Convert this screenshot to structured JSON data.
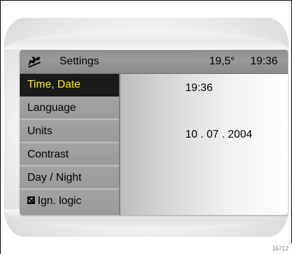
{
  "titlebar": {
    "icon": "settings-wrench-icon",
    "title": "Settings",
    "temperature": "19,5°",
    "time": "19:36"
  },
  "menu": {
    "items": [
      {
        "label": "Time, Date",
        "active": true
      },
      {
        "label": "Language",
        "active": false
      },
      {
        "label": "Units",
        "active": false
      },
      {
        "label": "Contrast",
        "active": false
      },
      {
        "label": "Day / Night",
        "active": false
      },
      {
        "label": "Ign. logic",
        "active": false,
        "checkbox": "checked-box-icon"
      }
    ]
  },
  "content": {
    "time_value": "19:36",
    "date_value": "10 . 07 . 2004"
  },
  "figure_id": "16712",
  "colors": {
    "active_text": "#ffee00",
    "active_bg": "#1a1a1a",
    "menu_bg": "#9e9e9e"
  }
}
